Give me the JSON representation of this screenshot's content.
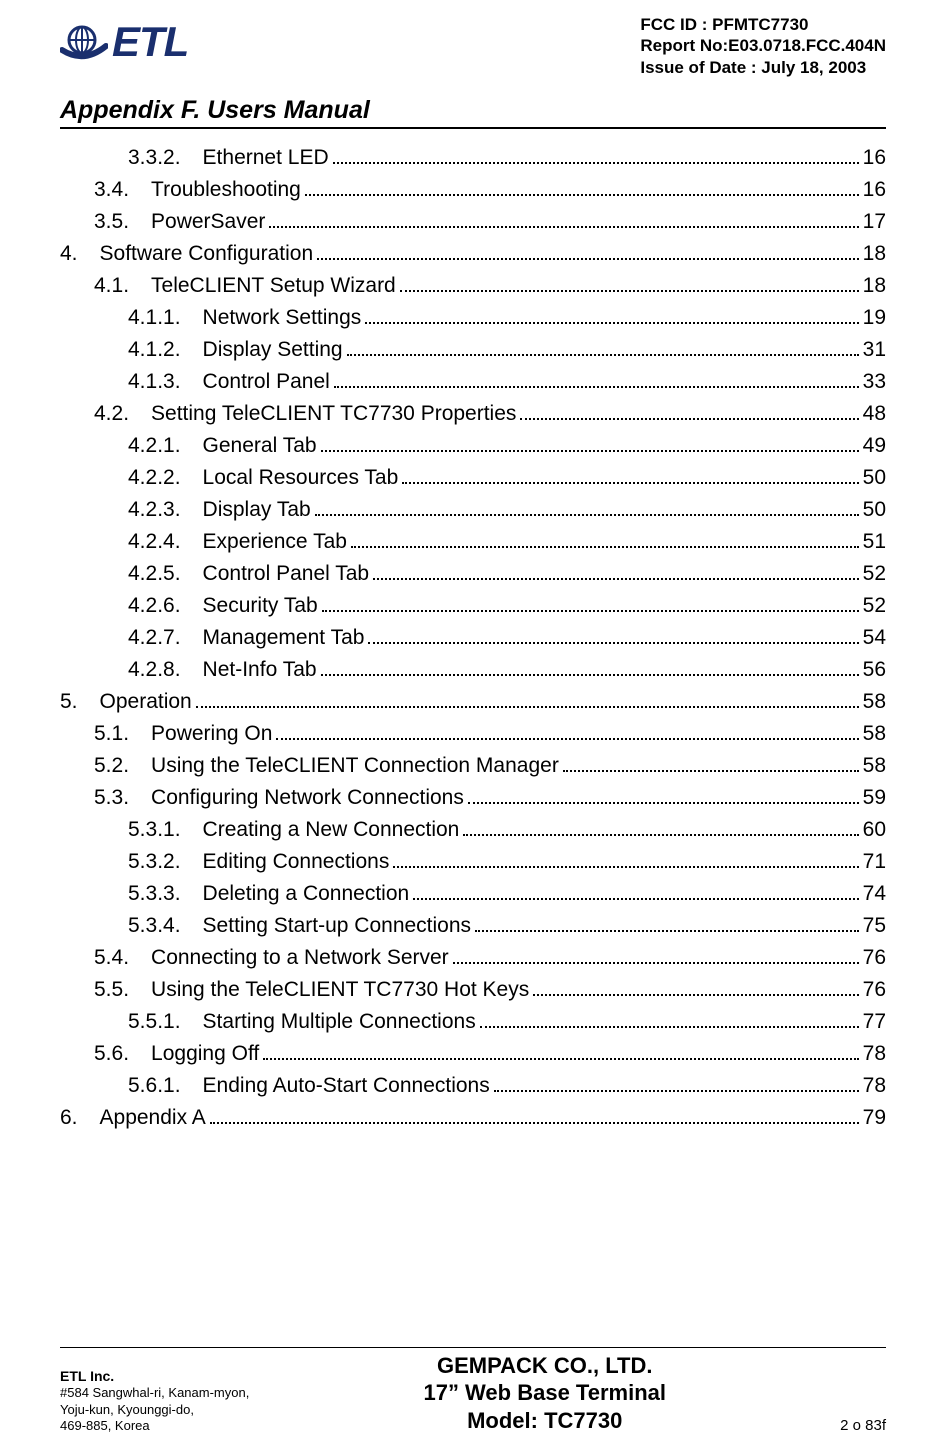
{
  "header": {
    "logo_text": "ETL",
    "fcc_id": "FCC ID : PFMTC7730",
    "report_no": "Report No:E03.0718.FCC.404N",
    "issue_date": "Issue of Date : July 18, 2003",
    "appendix_title": "Appendix F.  Users Manual"
  },
  "toc": [
    {
      "level": 3,
      "num": "3.3.2.",
      "title": "Ethernet LED",
      "page": "16"
    },
    {
      "level": 2,
      "num": "3.4.",
      "title": "Troubleshooting",
      "page": "16"
    },
    {
      "level": 2,
      "num": "3.5.",
      "title": "PowerSaver",
      "page": "17"
    },
    {
      "level": 1,
      "num": "4.",
      "title": "Software Configuration",
      "page": "18"
    },
    {
      "level": 2,
      "num": "4.1.",
      "title": "TeleCLIENT Setup Wizard",
      "page": "18"
    },
    {
      "level": 3,
      "num": "4.1.1.",
      "title": "Network Settings",
      "page": "19"
    },
    {
      "level": 3,
      "num": "4.1.2.",
      "title": "Display Setting",
      "page": "31"
    },
    {
      "level": 3,
      "num": "4.1.3.",
      "title": "Control Panel",
      "page": "33"
    },
    {
      "level": 2,
      "num": "4.2.",
      "title": "Setting TeleCLIENT TC7730 Properties",
      "page": "48"
    },
    {
      "level": 3,
      "num": "4.2.1.",
      "title": "General Tab",
      "page": "49"
    },
    {
      "level": 3,
      "num": "4.2.2.",
      "title": "Local Resources Tab",
      "page": "50"
    },
    {
      "level": 3,
      "num": "4.2.3.",
      "title": "Display Tab",
      "page": "50"
    },
    {
      "level": 3,
      "num": "4.2.4.",
      "title": "Experience Tab",
      "page": "51"
    },
    {
      "level": 3,
      "num": "4.2.5.",
      "title": "Control Panel Tab",
      "page": "52"
    },
    {
      "level": 3,
      "num": "4.2.6.",
      "title": "Security Tab",
      "page": "52"
    },
    {
      "level": 3,
      "num": "4.2.7.",
      "title": "Management Tab",
      "page": "54"
    },
    {
      "level": 3,
      "num": "4.2.8.",
      "title": "Net-Info Tab",
      "page": "56"
    },
    {
      "level": 1,
      "num": "5.",
      "title": "Operation",
      "page": "58"
    },
    {
      "level": 2,
      "num": "5.1.",
      "title": "Powering On",
      "page": "58"
    },
    {
      "level": 2,
      "num": "5.2.",
      "title": "Using the TeleCLIENT Connection Manager",
      "page": "58"
    },
    {
      "level": 2,
      "num": "5.3.",
      "title": "Configuring Network Connections",
      "page": "59"
    },
    {
      "level": 3,
      "num": "5.3.1.",
      "title": "Creating a New Connection",
      "page": "60"
    },
    {
      "level": 3,
      "num": "5.3.2.",
      "title": "Editing Connections",
      "page": "71"
    },
    {
      "level": 3,
      "num": "5.3.3.",
      "title": "Deleting a Connection",
      "page": "74"
    },
    {
      "level": 3,
      "num": "5.3.4.",
      "title": "Setting Start-up Connections",
      "page": "75"
    },
    {
      "level": 2,
      "num": "5.4.",
      "title": "Connecting to a Network Server",
      "page": "76"
    },
    {
      "level": 2,
      "num": "5.5.",
      "title": "Using the TeleCLIENT TC7730 Hot Keys",
      "page": "76"
    },
    {
      "level": 3,
      "num": "5.5.1.",
      "title": "Starting Multiple Connections",
      "page": "77"
    },
    {
      "level": 2,
      "num": "5.6.",
      "title": "Logging Off",
      "page": "78"
    },
    {
      "level": 3,
      "num": "5.6.1.",
      "title": "Ending Auto-Start Connections",
      "page": "78"
    },
    {
      "level": 1,
      "num": "6.",
      "title": "Appendix A",
      "page": "79"
    }
  ],
  "footer": {
    "company": "ETL Inc.",
    "addr1": "#584 Sangwhal-ri, Kanam-myon,",
    "addr2": "Yoju-kun, Kyounggi-do,",
    "addr3": "469-885, Korea",
    "center1": "GEMPACK CO., LTD.",
    "center2": "17” Web Base Terminal",
    "center3": "Model: TC7730",
    "page_number": "2 o 83f"
  }
}
